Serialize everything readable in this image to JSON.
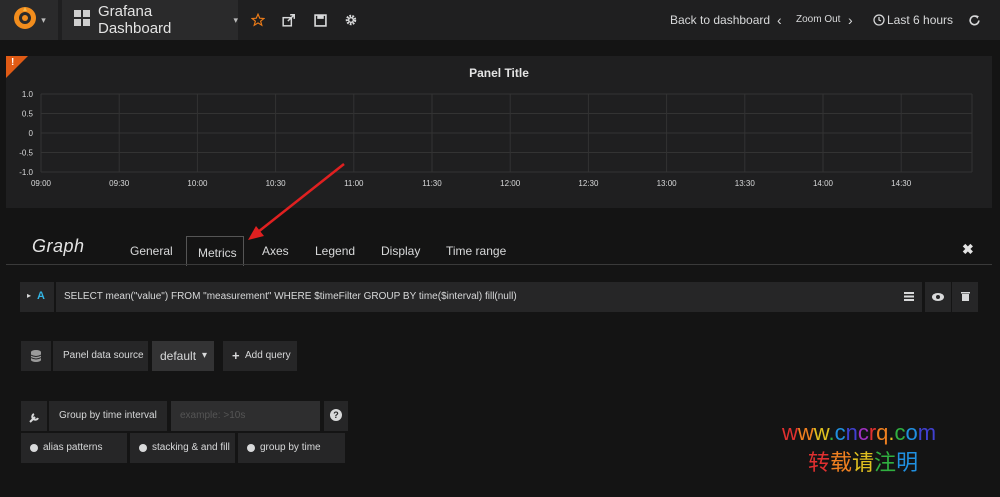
{
  "navbar": {
    "dashboard_title": "Grafana Dashboard",
    "back_label": "Back to dashboard",
    "zoom_label": "Zoom Out",
    "time_range_label": "Last 6 hours"
  },
  "panel": {
    "title": "Panel Title",
    "warning_mark": "!"
  },
  "chart_data": {
    "type": "line",
    "title": "Panel Title",
    "x_ticks": [
      "09:00",
      "09:30",
      "10:00",
      "10:30",
      "11:00",
      "11:30",
      "12:00",
      "12:30",
      "13:00",
      "13:30",
      "14:00",
      "14:30"
    ],
    "y_ticks": [
      "1.0",
      "0.5",
      "0",
      "-0.5",
      "-1.0"
    ],
    "ylim": [
      -1.0,
      1.0
    ],
    "grid": true,
    "series": []
  },
  "editor": {
    "title": "Graph",
    "tabs": [
      "General",
      "Metrics",
      "Axes",
      "Legend",
      "Display",
      "Time range"
    ],
    "active_tab": "Metrics",
    "close_glyph": "✖"
  },
  "query": {
    "ref_id": "A",
    "text": "SELECT mean(\"value\") FROM \"measurement\" WHERE $timeFilter GROUP BY time($interval) fill(null)"
  },
  "datasource": {
    "label": "Panel data source",
    "value": "default",
    "add_query": "Add query"
  },
  "options": {
    "group_by_label": "Group by time interval",
    "group_by_placeholder": "example: >10s",
    "help": "?",
    "alias_patterns": "alias patterns",
    "stacking": "stacking & and fill",
    "group_by_time": "group by time"
  },
  "watermark": {
    "line1": "www.cncrq.com",
    "line2": "转载请注明"
  }
}
